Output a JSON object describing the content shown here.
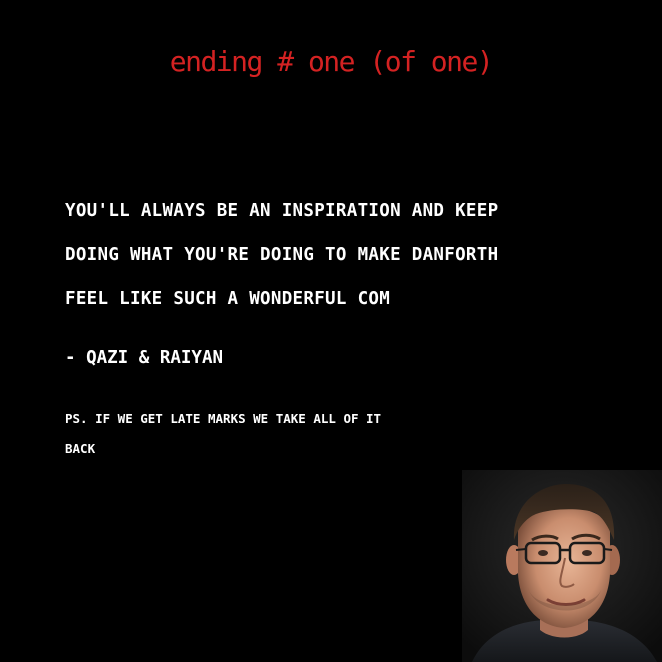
{
  "ending": {
    "title": "ending # one (of one)",
    "title_color": "#d42222"
  },
  "message": {
    "lines": [
      "YOU'LL ALWAYS BE AN INSPIRATION AND KEEP",
      "DOING WHAT YOU'RE DOING TO MAKE DANFORTH",
      "FEEL LIKE SUCH A WONDERFUL COM"
    ],
    "signature": "- QAZI & RAIYAN",
    "ps_lines": [
      "PS. IF WE GET LATE MARKS WE TAKE ALL OF IT",
      "BACK"
    ]
  },
  "colors": {
    "background": "#000000",
    "text": "#ffffff"
  },
  "icons": {
    "portrait": "person-portrait-icon"
  }
}
